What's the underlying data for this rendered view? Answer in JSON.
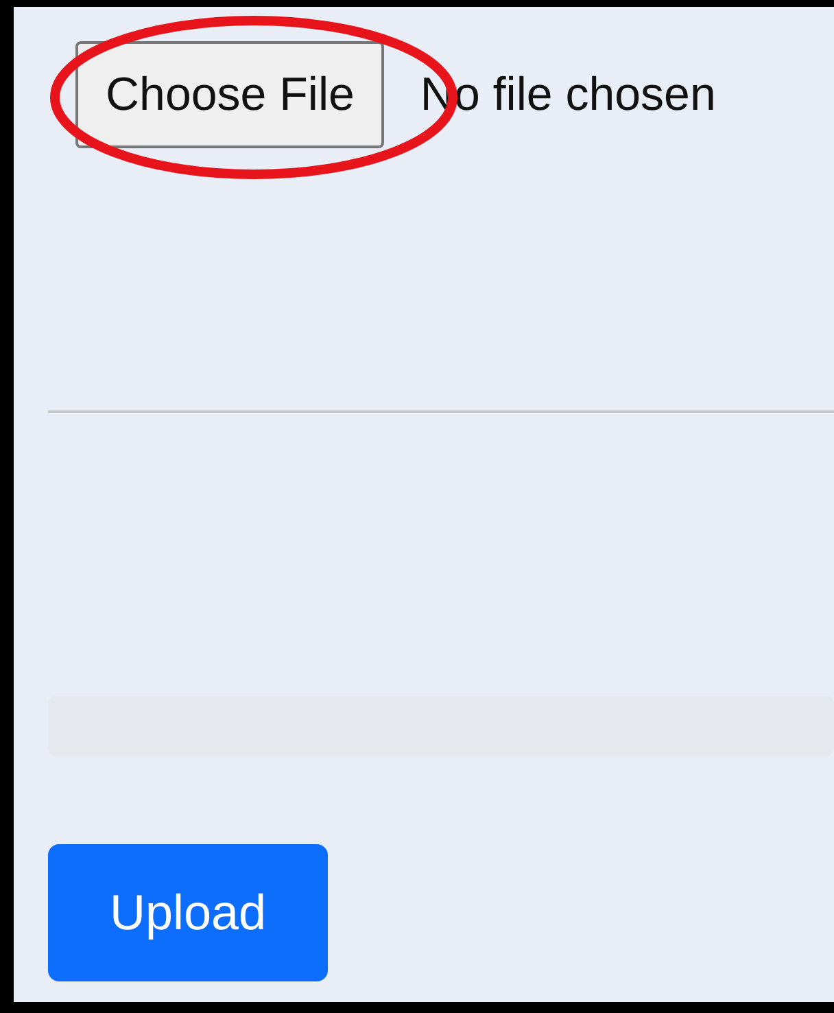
{
  "file_input": {
    "button": "Choose File",
    "status": "No file chosen",
    "highlighted": true
  },
  "progress": {
    "level": 0
  },
  "upload_button": {
    "label": "Upload"
  }
}
